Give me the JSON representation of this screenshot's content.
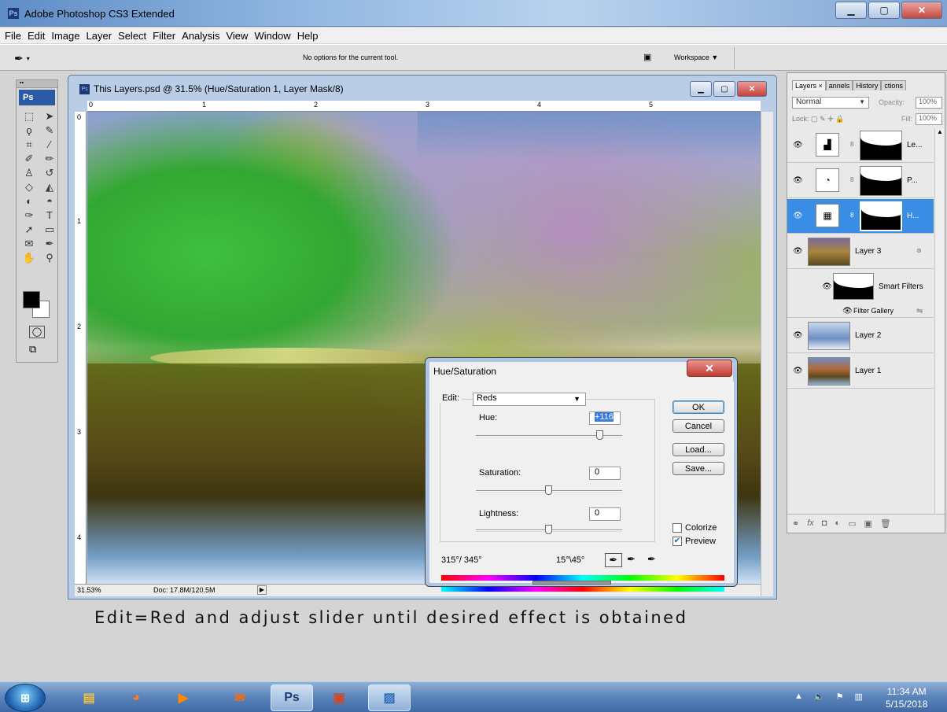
{
  "app": {
    "title": "Adobe Photoshop CS3 Extended",
    "badge": "Ps"
  },
  "menu": [
    "File",
    "Edit",
    "Image",
    "Layer",
    "Select",
    "Filter",
    "Analysis",
    "View",
    "Window",
    "Help"
  ],
  "options_bar": {
    "message": "No options for the current tool.",
    "workspace_label": "Workspace"
  },
  "toolbox": {
    "logo": "Ps"
  },
  "document": {
    "title": "This Layers.psd @ 31.5% (Hue/Saturation 1, Layer Mask/8)",
    "zoom": "31.53%",
    "doc_size": "Doc: 17.8M/120.5M",
    "ruler_top": [
      "0",
      "1",
      "2",
      "3",
      "4",
      "5"
    ],
    "ruler_left": [
      "0",
      "1",
      "2",
      "3",
      "4"
    ]
  },
  "dialog": {
    "title": "Hue/Saturation",
    "edit_label": "Edit:",
    "edit_value": "Reds",
    "hue_label": "Hue:",
    "hue_value": "+116",
    "hue_slider": 0.82,
    "saturation_label": "Saturation:",
    "saturation_value": "0",
    "lightness_label": "Lightness:",
    "lightness_value": "0",
    "buttons": {
      "ok": "OK",
      "cancel": "Cancel",
      "load": "Load...",
      "save": "Save..."
    },
    "colorize_label": "Colorize",
    "colorize_checked": false,
    "preview_label": "Preview",
    "preview_checked": true,
    "range_left": "315°/ 345°",
    "range_right": "15°\\45°"
  },
  "layers_panel": {
    "tabs": [
      "Layers ×",
      "annels",
      "History",
      "ctions"
    ],
    "blend_mode": "Normal",
    "opacity_label": "Opacity:",
    "opacity_value": "100%",
    "lock_label": "Lock:",
    "fill_label": "Fill:",
    "fill_value": "100%",
    "layers": [
      {
        "name": "Le...",
        "type": "adjustment"
      },
      {
        "name": "P...",
        "type": "adjustment"
      },
      {
        "name": "H...",
        "type": "adjustment",
        "selected": true
      },
      {
        "name": "Layer 3",
        "type": "smart-object"
      },
      {
        "name": "Smart Filters",
        "type": "filter-mask"
      },
      {
        "name": "Filter Gallery",
        "type": "filter"
      },
      {
        "name": "Layer 2",
        "type": "image"
      },
      {
        "name": "Layer 1",
        "type": "image"
      }
    ]
  },
  "caption": "Edit=Red and adjust slider until desired effect is obtained",
  "taskbar": {
    "time": "11:34 AM",
    "date": "5/15/2018",
    "ps_label": "Ps"
  }
}
